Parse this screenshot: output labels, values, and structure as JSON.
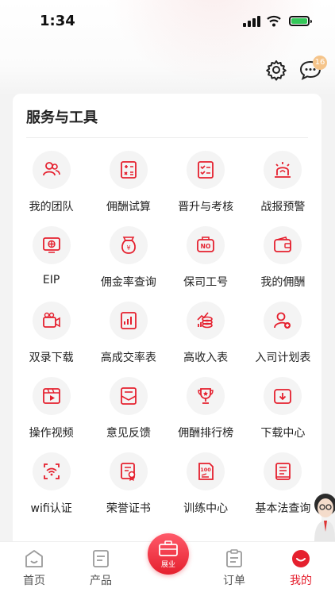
{
  "status_bar": {
    "time": "1:34"
  },
  "header": {
    "message_badge": "16"
  },
  "section": {
    "title": "服务与工具",
    "items": [
      {
        "label": "我的团队",
        "icon": "team-icon"
      },
      {
        "label": "佣酬试算",
        "icon": "calculator-icon"
      },
      {
        "label": "晋升与考核",
        "icon": "checklist-icon"
      },
      {
        "label": "战报预警",
        "icon": "alarm-light-icon"
      },
      {
        "label": "EIP",
        "icon": "monitor-globe-icon"
      },
      {
        "label": "佣金率查询",
        "icon": "money-bag-icon"
      },
      {
        "label": "保司工号",
        "icon": "no-badge-icon"
      },
      {
        "label": "我的佣酬",
        "icon": "wallet-icon"
      },
      {
        "label": "双录下载",
        "icon": "video-camera-icon"
      },
      {
        "label": "高成交率表",
        "icon": "bar-chart-icon"
      },
      {
        "label": "高收入表",
        "icon": "coins-chart-icon"
      },
      {
        "label": "入司计划表",
        "icon": "user-add-icon"
      },
      {
        "label": "操作视频",
        "icon": "video-player-icon"
      },
      {
        "label": "意见反馈",
        "icon": "feedback-mail-icon"
      },
      {
        "label": "佣酬排行榜",
        "icon": "trophy-icon"
      },
      {
        "label": "下载中心",
        "icon": "download-folder-icon"
      },
      {
        "label": "wifi认证",
        "icon": "wifi-scan-icon"
      },
      {
        "label": "荣誉证书",
        "icon": "certificate-icon"
      },
      {
        "label": "训练中心",
        "icon": "score-paper-icon"
      },
      {
        "label": "基本法查询",
        "icon": "book-icon"
      }
    ]
  },
  "tabbar": {
    "home": "首页",
    "product": "产品",
    "center": "展业",
    "orders": "订单",
    "mine": "我的"
  },
  "colors": {
    "accent": "#e5202e",
    "badge": "#f5c48a"
  }
}
